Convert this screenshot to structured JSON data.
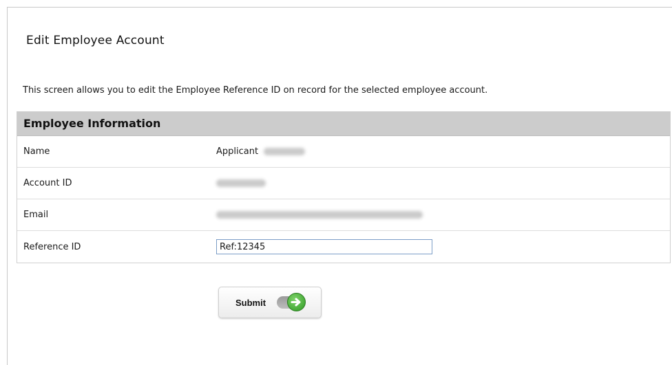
{
  "page": {
    "title": "Edit Employee Account",
    "intro": "This screen allows you to edit the Employee Reference ID on record for the selected employee account."
  },
  "employee_info": {
    "header": "Employee Information",
    "rows": [
      {
        "label": "Name",
        "value": "Applicant"
      },
      {
        "label": "Account ID"
      },
      {
        "label": "Email"
      },
      {
        "label": "Reference ID",
        "input_value": "Ref:12345"
      }
    ]
  },
  "submit": {
    "label": "Submit",
    "icon": "arrow-right-icon"
  }
}
